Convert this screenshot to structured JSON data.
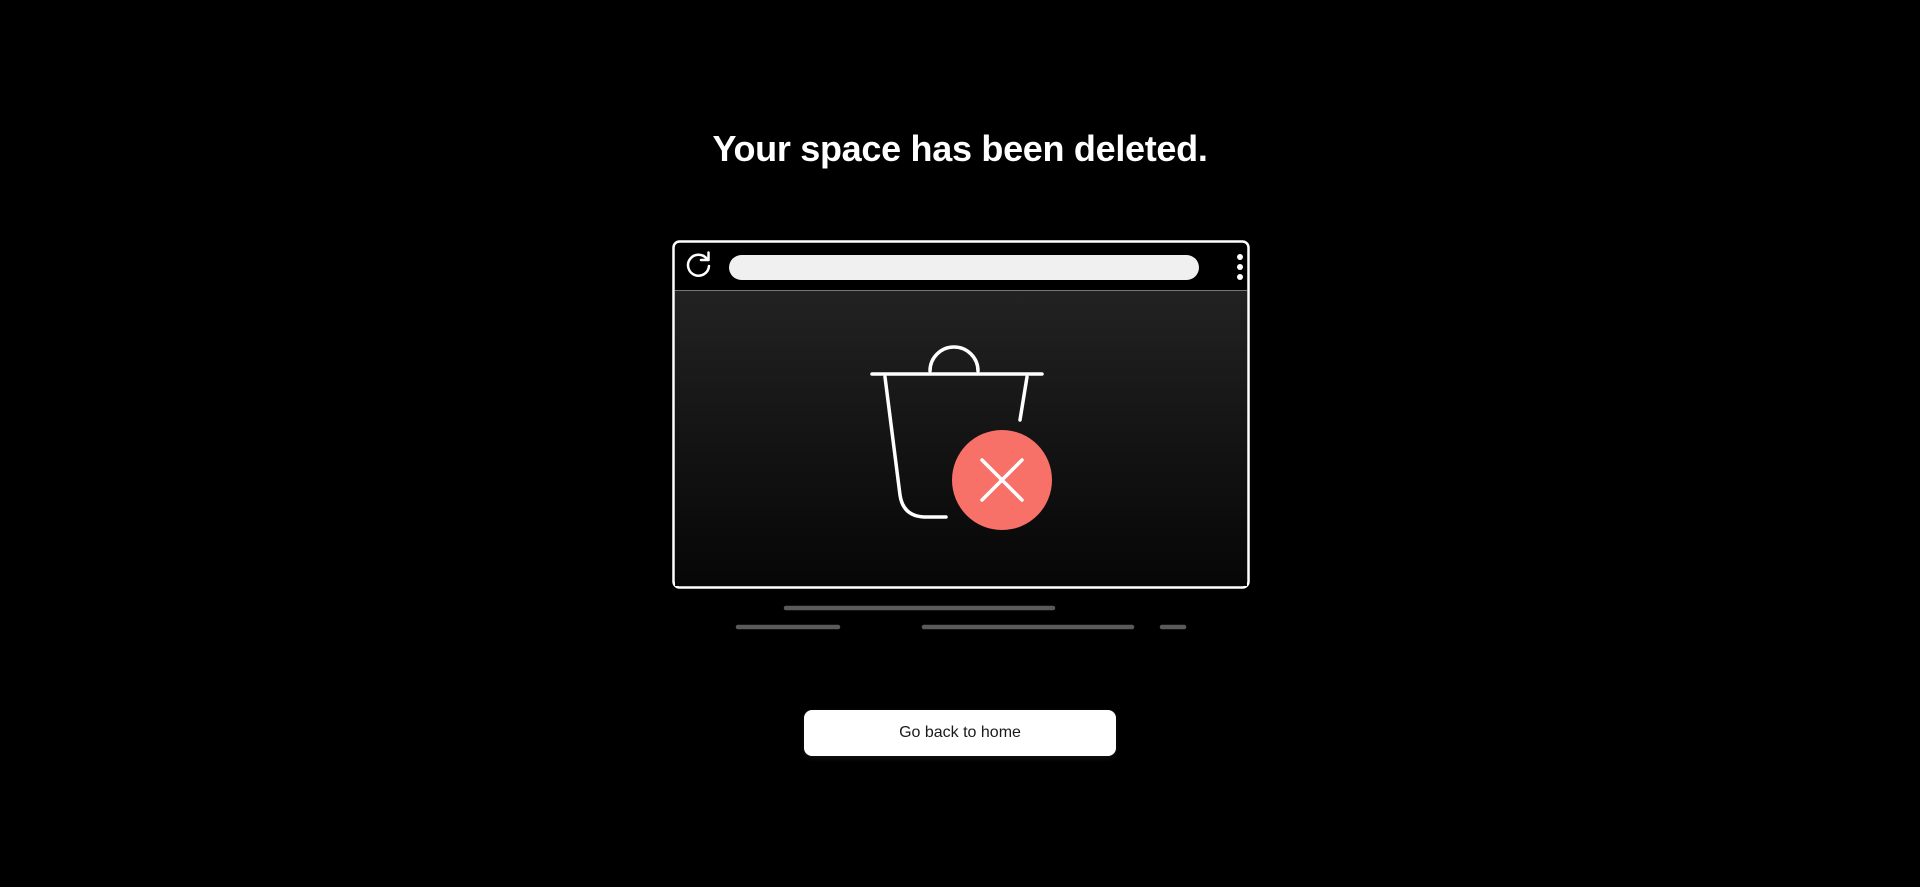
{
  "page": {
    "title": "Your space has been deleted.",
    "home_button_label": "Go back to home"
  },
  "illustration": {
    "icons": [
      "reload-icon",
      "more-vertical-icon",
      "trash-bin-icon",
      "close-icon"
    ],
    "colors": {
      "background": "#000000",
      "frame": "#ffffff",
      "address_bar": "#f0f0f0",
      "error_badge": "#f87168",
      "shadow_lines": "#5a5a5a"
    }
  }
}
